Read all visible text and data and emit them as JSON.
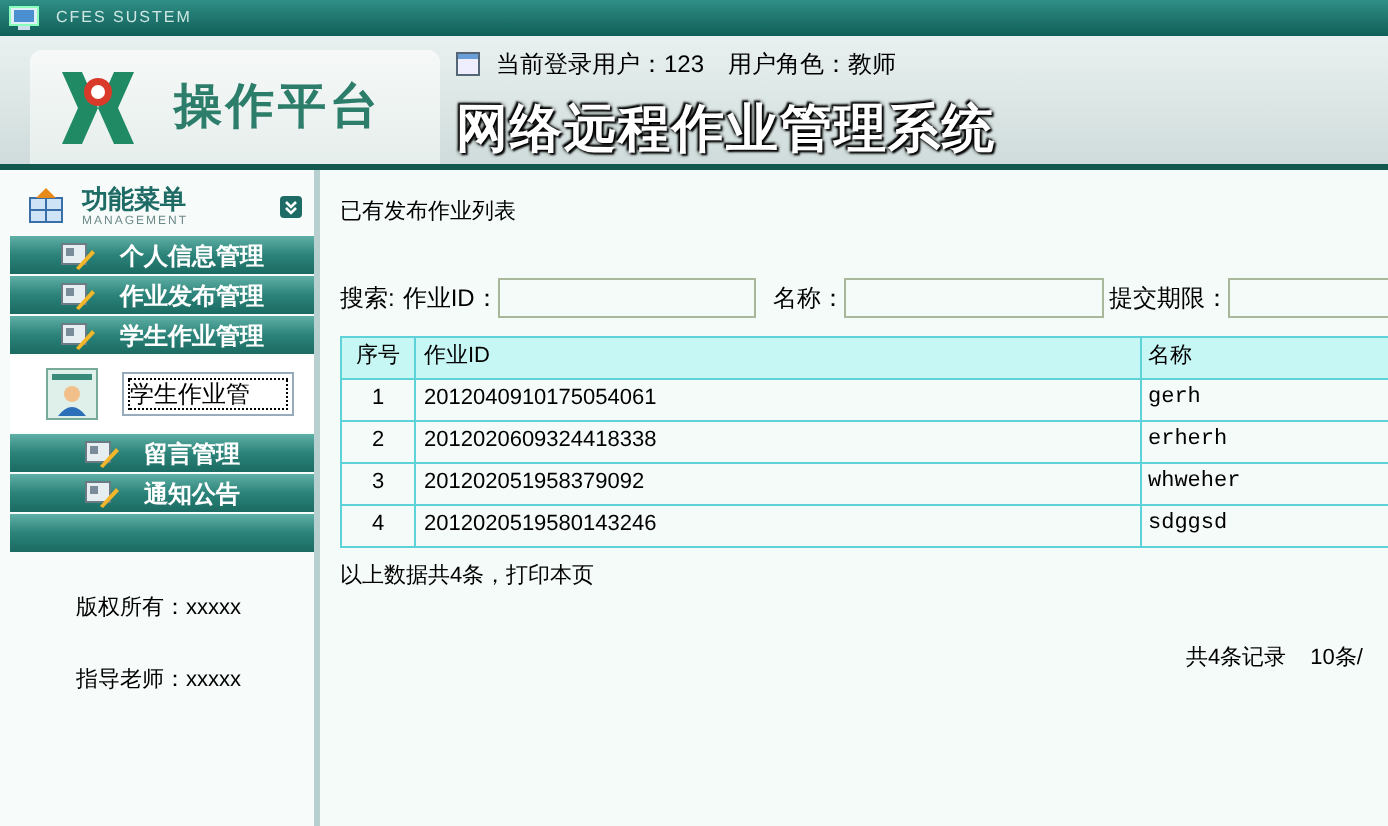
{
  "system_bar": {
    "title": "CFES SUSTEM"
  },
  "header": {
    "platform": "操作平台",
    "user_line": "当前登录用户：123",
    "role_line": "用户角色：教师",
    "title": "网络远程作业管理系统"
  },
  "sidebar": {
    "menu_title": "功能菜单",
    "menu_subtitle": "MANAGEMENT",
    "items": [
      {
        "label": "个人信息管理"
      },
      {
        "label": "作业发布管理"
      },
      {
        "label": "学生作业管理",
        "children": [
          {
            "label": "学生作业管"
          }
        ]
      },
      {
        "label": "留言管理"
      },
      {
        "label": "通知公告"
      }
    ],
    "footer": [
      "版权所有：xxxxx",
      "指导老师：xxxxx"
    ]
  },
  "main": {
    "heading": "已有发布作业列表",
    "search": {
      "label": "搜索:",
      "fields": [
        {
          "label": "作业ID："
        },
        {
          "label": "名称："
        },
        {
          "label": "提交期限："
        }
      ]
    },
    "table": {
      "columns": [
        "序号",
        "作业ID",
        "名称"
      ],
      "rows": [
        [
          "1",
          "2012040910175054061",
          "gerh"
        ],
        [
          "2",
          "2012020609324418338",
          "erherh"
        ],
        [
          "3",
          "201202051958379092",
          "whweher"
        ],
        [
          "4",
          "2012020519580143246",
          "sdggsd"
        ]
      ]
    },
    "summary": "以上数据共4条，打印本页",
    "pager": [
      "共4条记录",
      "10条/"
    ]
  }
}
